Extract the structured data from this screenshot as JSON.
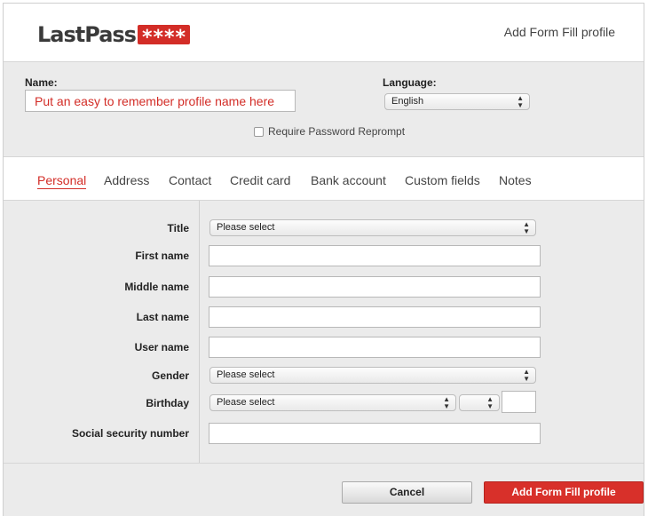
{
  "header": {
    "logo_text": "LastPass",
    "logo_stars": "****",
    "title": "Add Form Fill profile"
  },
  "profile": {
    "name_label": "Name:",
    "name_placeholder": "Put an easy to remember profile name here",
    "language_label": "Language:",
    "language_value": "English",
    "reprompt_label": "Require Password Reprompt"
  },
  "tabs": [
    {
      "label": "Personal",
      "active": true
    },
    {
      "label": "Address"
    },
    {
      "label": "Contact"
    },
    {
      "label": "Credit card"
    },
    {
      "label": "Bank account"
    },
    {
      "label": "Custom fields"
    },
    {
      "label": "Notes"
    }
  ],
  "form": {
    "title_label": "Title",
    "title_value": "Please select",
    "first_name_label": "First name",
    "middle_name_label": "Middle name",
    "last_name_label": "Last name",
    "user_name_label": "User name",
    "gender_label": "Gender",
    "gender_value": "Please select",
    "birthday_label": "Birthday",
    "birthday_value": "Please select",
    "ssn_label": "Social security number"
  },
  "footer": {
    "cancel_label": "Cancel",
    "add_label": "Add Form Fill profile"
  },
  "colors": {
    "brand_red": "#d32d27",
    "panel_gray": "#ebebeb"
  },
  "icons": {
    "select_arrows": "up-down-arrows-icon"
  }
}
